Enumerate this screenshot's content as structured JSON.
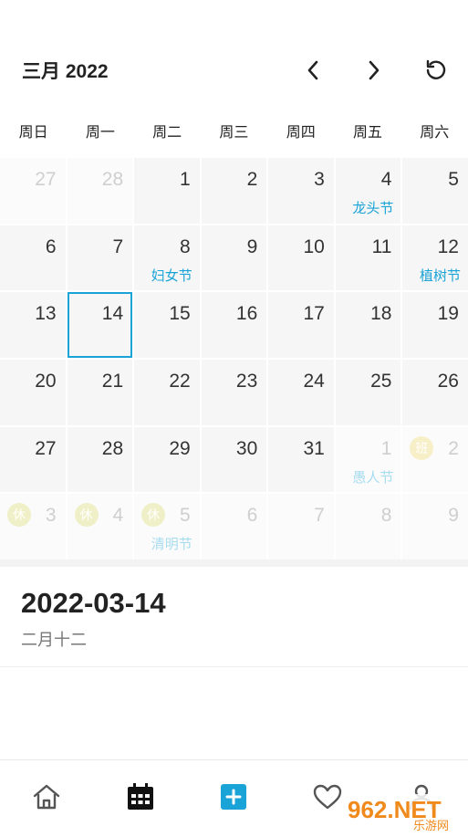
{
  "header": {
    "month_title": "三月 2022",
    "prev_icon": "chevron-left-icon",
    "next_icon": "chevron-right-icon",
    "refresh_icon": "refresh-icon"
  },
  "weekdays": [
    "周日",
    "周一",
    "周二",
    "周三",
    "周四",
    "周五",
    "周六"
  ],
  "calendar": {
    "rows": [
      [
        {
          "day": "27",
          "outside": true,
          "holiday": "",
          "badge": ""
        },
        {
          "day": "28",
          "outside": true,
          "holiday": "",
          "badge": ""
        },
        {
          "day": "1",
          "outside": false,
          "holiday": "",
          "badge": ""
        },
        {
          "day": "2",
          "outside": false,
          "holiday": "",
          "badge": ""
        },
        {
          "day": "3",
          "outside": false,
          "holiday": "",
          "badge": ""
        },
        {
          "day": "4",
          "outside": false,
          "holiday": "龙头节",
          "badge": ""
        },
        {
          "day": "5",
          "outside": false,
          "holiday": "",
          "badge": ""
        }
      ],
      [
        {
          "day": "6",
          "outside": false,
          "holiday": "",
          "badge": ""
        },
        {
          "day": "7",
          "outside": false,
          "holiday": "",
          "badge": ""
        },
        {
          "day": "8",
          "outside": false,
          "holiday": "妇女节",
          "badge": ""
        },
        {
          "day": "9",
          "outside": false,
          "holiday": "",
          "badge": ""
        },
        {
          "day": "10",
          "outside": false,
          "holiday": "",
          "badge": ""
        },
        {
          "day": "11",
          "outside": false,
          "holiday": "",
          "badge": ""
        },
        {
          "day": "12",
          "outside": false,
          "holiday": "植树节",
          "badge": ""
        }
      ],
      [
        {
          "day": "13",
          "outside": false,
          "holiday": "",
          "badge": ""
        },
        {
          "day": "14",
          "outside": false,
          "holiday": "",
          "badge": "",
          "selected": true
        },
        {
          "day": "15",
          "outside": false,
          "holiday": "",
          "badge": ""
        },
        {
          "day": "16",
          "outside": false,
          "holiday": "",
          "badge": ""
        },
        {
          "day": "17",
          "outside": false,
          "holiday": "",
          "badge": ""
        },
        {
          "day": "18",
          "outside": false,
          "holiday": "",
          "badge": ""
        },
        {
          "day": "19",
          "outside": false,
          "holiday": "",
          "badge": ""
        }
      ],
      [
        {
          "day": "20",
          "outside": false,
          "holiday": "",
          "badge": ""
        },
        {
          "day": "21",
          "outside": false,
          "holiday": "",
          "badge": ""
        },
        {
          "day": "22",
          "outside": false,
          "holiday": "",
          "badge": ""
        },
        {
          "day": "23",
          "outside": false,
          "holiday": "",
          "badge": ""
        },
        {
          "day": "24",
          "outside": false,
          "holiday": "",
          "badge": ""
        },
        {
          "day": "25",
          "outside": false,
          "holiday": "",
          "badge": ""
        },
        {
          "day": "26",
          "outside": false,
          "holiday": "",
          "badge": ""
        }
      ],
      [
        {
          "day": "27",
          "outside": false,
          "holiday": "",
          "badge": ""
        },
        {
          "day": "28",
          "outside": false,
          "holiday": "",
          "badge": ""
        },
        {
          "day": "29",
          "outside": false,
          "holiday": "",
          "badge": ""
        },
        {
          "day": "30",
          "outside": false,
          "holiday": "",
          "badge": ""
        },
        {
          "day": "31",
          "outside": false,
          "holiday": "",
          "badge": ""
        },
        {
          "day": "1",
          "outside": true,
          "holiday": "愚人节",
          "badge": ""
        },
        {
          "day": "2",
          "outside": true,
          "holiday": "",
          "badge": "班"
        }
      ],
      [
        {
          "day": "3",
          "outside": true,
          "holiday": "",
          "badge": "休"
        },
        {
          "day": "4",
          "outside": true,
          "holiday": "",
          "badge": "休"
        },
        {
          "day": "5",
          "outside": true,
          "holiday": "清明节",
          "badge": "休"
        },
        {
          "day": "6",
          "outside": true,
          "holiday": "",
          "badge": ""
        },
        {
          "day": "7",
          "outside": true,
          "holiday": "",
          "badge": ""
        },
        {
          "day": "8",
          "outside": true,
          "holiday": "",
          "badge": ""
        },
        {
          "day": "9",
          "outside": true,
          "holiday": "",
          "badge": ""
        }
      ]
    ]
  },
  "detail": {
    "date": "2022-03-14",
    "lunar": "二月十二"
  },
  "bottom_nav": [
    {
      "icon": "home-icon",
      "active": false
    },
    {
      "icon": "calendar-icon",
      "active": true
    },
    {
      "icon": "add-icon",
      "active": false
    },
    {
      "icon": "heart-icon",
      "active": false
    },
    {
      "icon": "profile-icon",
      "active": false
    }
  ],
  "watermark": {
    "brand": "962.NET",
    "sub": "乐游网"
  },
  "colors": {
    "accent": "#1aa3d6",
    "text": "#222222",
    "cell_bg": "#f6f6f6"
  }
}
